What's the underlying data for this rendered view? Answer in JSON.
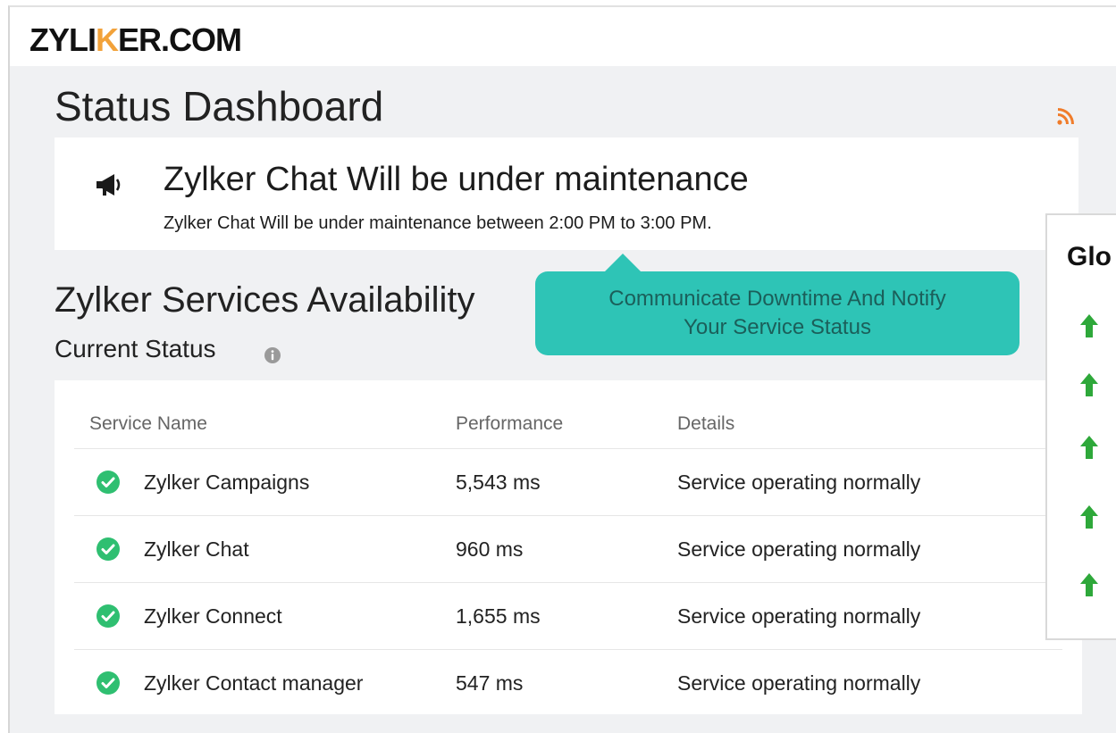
{
  "brand": {
    "logo_prefix": "ZYLI",
    "logo_k": "K",
    "logo_suffix": "ER.COM",
    "accent_color": "#f2a23a"
  },
  "page": {
    "title": "Status Dashboard",
    "rss_icon": "rss-icon"
  },
  "announcement": {
    "icon": "megaphone-icon",
    "title": "Zylker Chat Will be under maintenance",
    "body": "Zylker Chat Will be under maintenance between 2:00 PM to 3:00 PM."
  },
  "availability": {
    "section_title": "Zylker Services Availability",
    "subtitle": "Current Status",
    "info_icon": "info-icon"
  },
  "callout": {
    "line1": "Communicate Downtime And Notify",
    "line2": "Your Service Status",
    "color": "#2ec4b6"
  },
  "table": {
    "headers": [
      "Service Name",
      "Performance",
      "Details"
    ],
    "rows": [
      {
        "status_icon": "check-circle-icon",
        "name": "Zylker Campaigns",
        "performance": "5,543 ms",
        "details": "Service operating normally"
      },
      {
        "status_icon": "check-circle-icon",
        "name": "Zylker Chat",
        "performance": "960 ms",
        "details": "Service operating normally"
      },
      {
        "status_icon": "check-circle-icon",
        "name": "Zylker Connect",
        "performance": "1,655 ms",
        "details": "Service operating normally"
      },
      {
        "status_icon": "check-circle-icon",
        "name": "Zylker Contact manager",
        "performance": "547 ms",
        "details": "Service operating normally"
      }
    ],
    "status_color": "#2fbf71"
  },
  "global_panel": {
    "title": "Glo",
    "arrow_icon": "arrow-up-icon",
    "arrow_color": "#2ea83a",
    "arrow_count": 5
  }
}
